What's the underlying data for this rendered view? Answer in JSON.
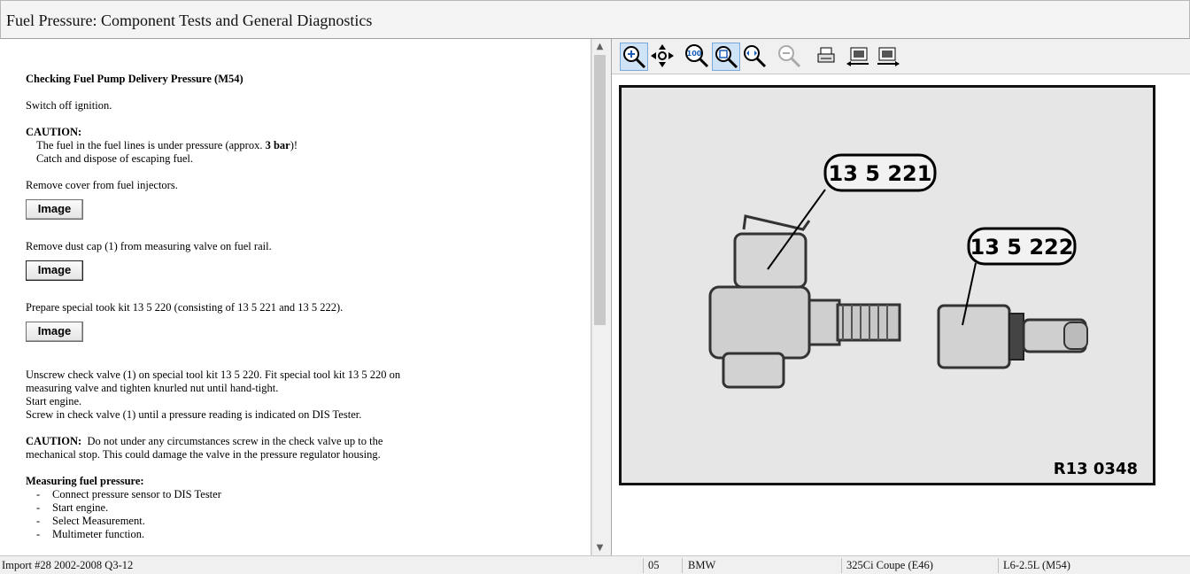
{
  "window": {
    "title": "Fuel Pressure:  Component Tests and General Diagnostics"
  },
  "left": {
    "heading": "Checking Fuel Pump Delivery Pressure (M54)",
    "step1": "Switch off ignition.",
    "caution1": {
      "label": "CAUTION:",
      "line1_pre": "The fuel in the fuel lines is under pressure (approx. ",
      "line1_bold": "3 bar",
      "line1_post": ")!",
      "line2": "Catch and dispose of escaping fuel."
    },
    "step2": "Remove cover from fuel injectors.",
    "image_button_label": "Image",
    "step3": "Remove dust cap (1) from measuring valve on fuel rail.",
    "step4": "Prepare special took kit 13 5 220 (consisting of 13 5 221 and 13 5 222).",
    "step5_lines": [
      "Unscrew check valve (1) on special tool kit 13 5 220. Fit special tool kit 13 5 220 on",
      "measuring valve and tighten knurled nut until hand-tight.",
      "Start engine.",
      "Screw in check valve (1) until a pressure reading is indicated on DIS Tester."
    ],
    "caution2": {
      "label": "CAUTION:",
      "text1": "  Do not under any circumstances screw in the check valve up to the",
      "text2": "mechanical stop. This could damage the valve in the pressure regulator housing."
    },
    "measuring": {
      "heading": "Measuring fuel pressure:",
      "dash": "-",
      "items": [
        "Connect pressure sensor to DIS Tester",
        "Start engine.",
        "Select Measurement.",
        "Multimeter function."
      ]
    }
  },
  "toolbar_icons": [
    "zoom-in-icon",
    "pan-icon",
    "zoom-100-icon",
    "zoom-fit-icon",
    "zoom-width-icon",
    "zoom-out-icon",
    "print-icon",
    "previous-image-icon",
    "next-image-icon"
  ],
  "figure": {
    "callout1": "13 5 221",
    "callout2": "13 5 222",
    "figure_code": "R13 0348"
  },
  "status": {
    "import": "Import #28 2002-2008 Q3-12",
    "code": "05",
    "make": "BMW",
    "model": "325Ci Coupe (E46)",
    "engine": "L6-2.5L (M54)"
  }
}
